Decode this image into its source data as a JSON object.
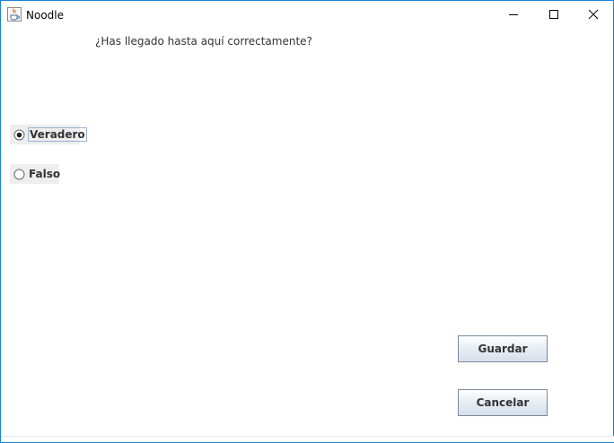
{
  "window": {
    "title": "Noodle",
    "app_icon": "java-coffee-icon",
    "controls": {
      "minimize_icon": "minimize-icon",
      "maximize_icon": "maximize-icon",
      "close_icon": "close-icon"
    },
    "accent_color": "#1883d7"
  },
  "question": {
    "text": "¿Has llegado hasta aquí correctamente?"
  },
  "answers": {
    "options": [
      {
        "label": "Veradero",
        "selected": true
      },
      {
        "label": "Falso",
        "selected": false
      }
    ]
  },
  "actions": {
    "save_label": "Guardar",
    "cancel_label": "Cancelar"
  }
}
